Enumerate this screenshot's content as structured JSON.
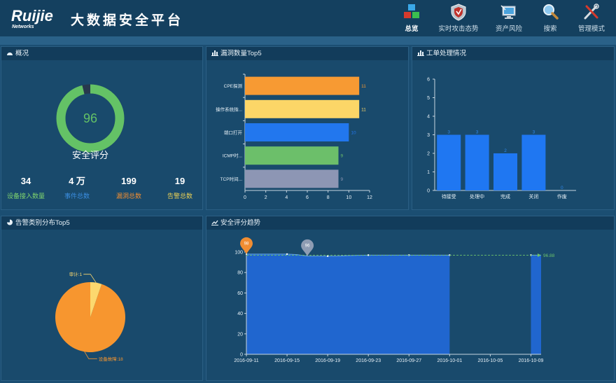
{
  "header": {
    "brand": "Ruijie",
    "brand_sub": "Networks",
    "title": "大数据安全平台",
    "nav": [
      {
        "label": "总览",
        "icon": "overview-icon",
        "active": true
      },
      {
        "label": "实时攻击态势",
        "icon": "shield-icon",
        "active": false
      },
      {
        "label": "资产风险",
        "icon": "monitor-icon",
        "active": false
      },
      {
        "label": "搜索",
        "icon": "search-icon",
        "active": false
      },
      {
        "label": "管理模式",
        "icon": "tools-icon",
        "active": false
      }
    ]
  },
  "overview": {
    "title": "概况",
    "score": "96",
    "score_value": 96,
    "score_label": "安全评分",
    "stats": [
      {
        "value": "34",
        "label": "设备接入数量",
        "color": "#7fd36e"
      },
      {
        "value": "4 万",
        "label": "事件总数",
        "color": "#3a8de0"
      },
      {
        "value": "199",
        "label": "漏洞总数",
        "color": "#f08d32"
      },
      {
        "value": "19",
        "label": "告警总数",
        "color": "#e8cf55"
      }
    ]
  },
  "vuln": {
    "title": "漏洞数量Top5",
    "chart_data": {
      "type": "bar",
      "orientation": "horizontal",
      "categories": [
        "CPE探测",
        "操作系统指...",
        "端口打开",
        "ICMP时...",
        "TCP时间..."
      ],
      "values": [
        11,
        11,
        10,
        9,
        9
      ],
      "colors": [
        "#f79a33",
        "#fcd667",
        "#2277ee",
        "#6cbf6a",
        "#8d96b4"
      ],
      "xlim": [
        0,
        12
      ],
      "xticks": [
        0,
        2,
        4,
        6,
        8,
        10,
        12
      ]
    }
  },
  "tickets": {
    "title": "工单处理情况",
    "chart_data": {
      "type": "bar",
      "categories": [
        "待接受",
        "处理中",
        "完成",
        "关闭",
        "作废"
      ],
      "values": [
        3,
        3,
        2,
        3,
        0
      ],
      "ylim": [
        0,
        6
      ],
      "yticks": [
        0,
        1,
        2,
        3,
        4,
        5,
        6
      ],
      "color": "#1f77f2"
    }
  },
  "alerts": {
    "title": "告警类别分布Top5",
    "chart_data": {
      "type": "pie",
      "slices": [
        {
          "label": "设备故障:18",
          "value": 18,
          "color": "#f7962f"
        },
        {
          "label": "审计:1",
          "value": 1,
          "color": "#fcd86e"
        }
      ]
    }
  },
  "trend": {
    "title": "安全评分趋势",
    "max_marker": "98",
    "min_marker": "96",
    "average_label": "96.88",
    "chart_data": {
      "type": "area",
      "x": [
        "2016-09-11",
        "2016-09-12",
        "2016-09-13",
        "2016-09-14",
        "2016-09-15",
        "2016-09-16",
        "2016-09-17",
        "2016-09-18",
        "2016-09-19",
        "2016-09-20",
        "2016-09-21",
        "2016-09-22",
        "2016-09-23",
        "2016-09-24",
        "2016-09-25",
        "2016-09-26",
        "2016-09-27",
        "2016-09-28",
        "2016-09-29",
        "2016-09-30",
        "2016-10-01",
        "2016-10-02",
        "2016-10-03",
        "2016-10-04",
        "2016-10-05",
        "2016-10-06",
        "2016-10-07",
        "2016-10-08",
        "2016-10-09",
        "2016-10-10"
      ],
      "values": [
        98,
        98,
        98,
        98,
        98,
        97.5,
        96,
        96,
        96,
        96,
        96.5,
        96.8,
        97,
        97,
        97,
        97,
        97,
        97,
        97,
        97,
        97,
        null,
        null,
        null,
        null,
        null,
        null,
        null,
        97,
        97
      ],
      "average": 96.88,
      "xticks": [
        "2016-09-11",
        "2016-09-15",
        "2016-09-19",
        "2016-09-23",
        "2016-09-27",
        "2016-10-01",
        "2016-10-05",
        "2016-10-09"
      ],
      "ylim": [
        0,
        100
      ],
      "yticks": [
        0,
        20,
        40,
        60,
        80,
        100
      ],
      "color": "#2066cf"
    }
  }
}
